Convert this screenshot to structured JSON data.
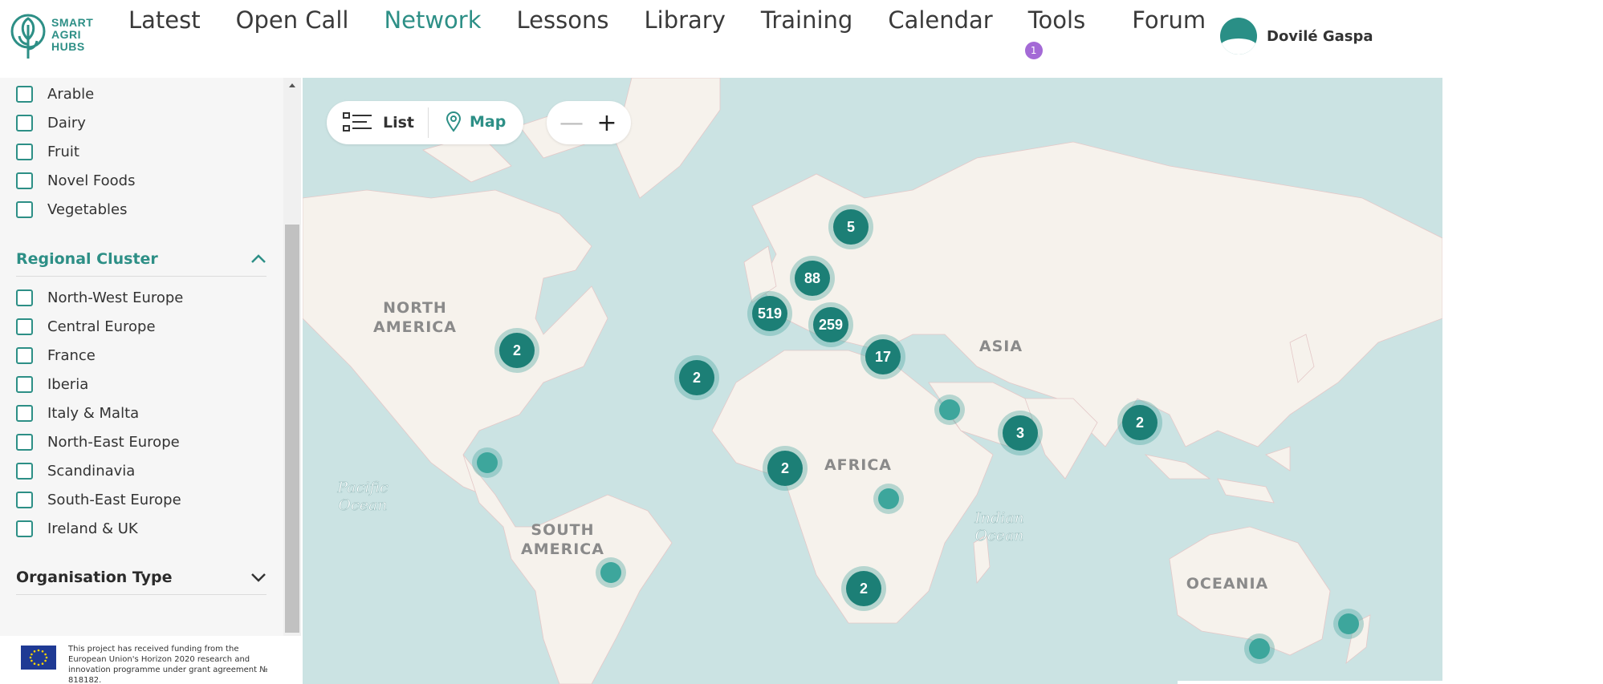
{
  "app": {
    "logo_lines": [
      "SMART",
      "AGRI",
      "HUBS"
    ]
  },
  "nav": {
    "items": [
      "Latest",
      "Open Call",
      "Network",
      "Lessons",
      "Library",
      "Training",
      "Calendar",
      "Tools",
      "Forum"
    ],
    "active": "Network",
    "tools_badge": "1"
  },
  "user": {
    "name": "Dovilé Gaspa"
  },
  "sidebar": {
    "sector_options": [
      "Arable",
      "Dairy",
      "Fruit",
      "Novel Foods",
      "Vegetables"
    ],
    "regional_cluster": {
      "title": "Regional Cluster",
      "options": [
        "North-West Europe",
        "Central Europe",
        "France",
        "Iberia",
        "Italy & Malta",
        "North-East Europe",
        "Scandinavia",
        "South-East Europe",
        "Ireland & UK"
      ]
    },
    "organisation_type": {
      "title": "Organisation Type"
    },
    "footer_text": "This project has received funding from the European Union's Horizon 2020 research and innovation programme under grant agreement № 818182."
  },
  "map": {
    "view_toggle": {
      "list_label": "List",
      "map_label": "Map",
      "active": "Map"
    },
    "zoom": {
      "out_label": "—",
      "in_label": "+"
    },
    "continent_labels": {
      "north_america": [
        "NORTH",
        "AMERICA"
      ],
      "south_america": [
        "SOUTH",
        "AMERICA"
      ],
      "africa": "AFRICA",
      "asia": "ASIA",
      "oceania": "OCEANIA"
    },
    "ocean_labels": {
      "pacific": [
        "Pacific",
        "Ocean"
      ],
      "indian": [
        "Indian",
        "Ocean"
      ]
    },
    "clusters": {
      "scandinavia": "5",
      "north_sea": "88",
      "western_europe": "519",
      "central_europe": "259",
      "middle_east": "17",
      "usa_east": "2",
      "atlantic": "2",
      "india": "3",
      "se_asia": "2",
      "west_africa": "2",
      "south_africa": "2"
    },
    "colors": {
      "marker": "#1c7f76",
      "marker_light": "#3da69c",
      "accent": "#2d8f86",
      "water": "#cbe3e3",
      "land": "#f6f2ec"
    }
  }
}
